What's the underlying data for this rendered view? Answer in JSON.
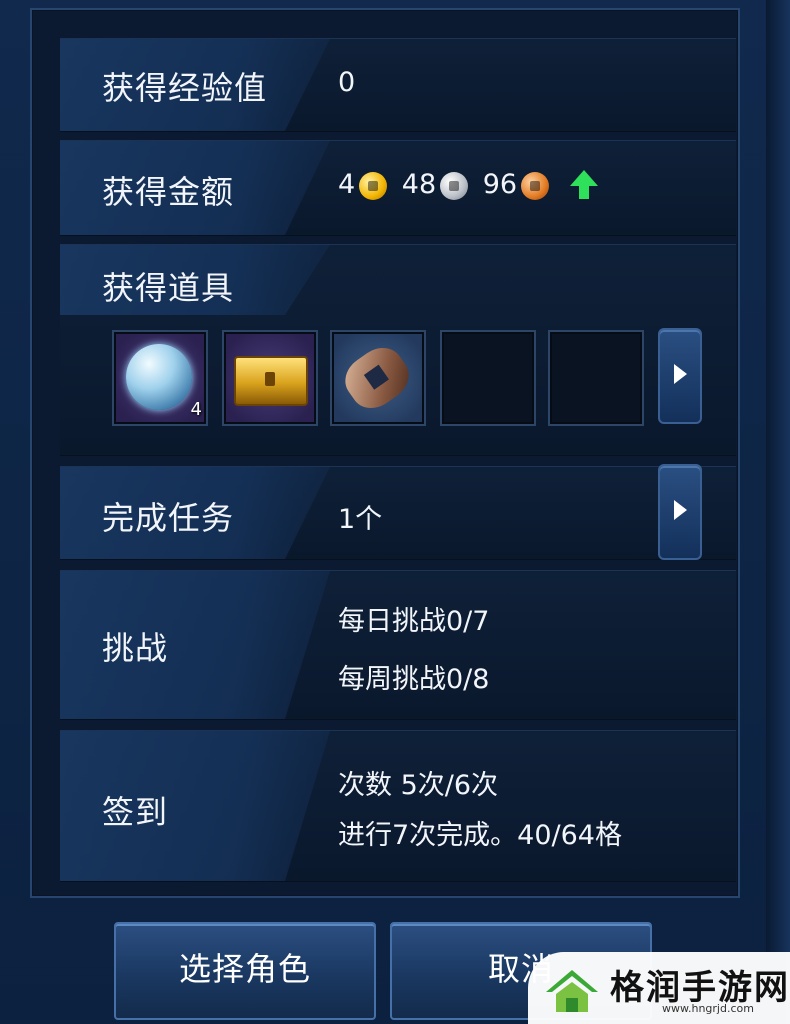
{
  "rows": {
    "exp": {
      "label": "获得经验值",
      "value": "0"
    },
    "money": {
      "label": "获得金额",
      "gold": "4",
      "silver": "48",
      "copper": "96"
    },
    "items": {
      "label": "获得道具",
      "orb_count": "4"
    },
    "quest": {
      "label": "完成任务",
      "value": "1个"
    },
    "challenge": {
      "label": "挑战",
      "daily": "每日挑战0/7",
      "weekly": "每周挑战0/8"
    },
    "checkin": {
      "label": "签到",
      "count": "次数 5次/6次",
      "progress": "进行7次完成。40/64格"
    }
  },
  "buttons": {
    "select_role": "选择角色",
    "cancel": "取消"
  },
  "watermark": {
    "name": "格润手游网",
    "url": "www.hngrjd.com"
  },
  "colors": {
    "gold_coin": "#f2b400",
    "silver_coin": "#b9bec6",
    "copper_coin": "#e27a22",
    "up_arrow": "#2ee05a"
  },
  "icons": {
    "item_slot_1": "crystal-orb-icon",
    "item_slot_2": "golden-chest-icon",
    "item_slot_3": "ancient-coin-icon"
  }
}
